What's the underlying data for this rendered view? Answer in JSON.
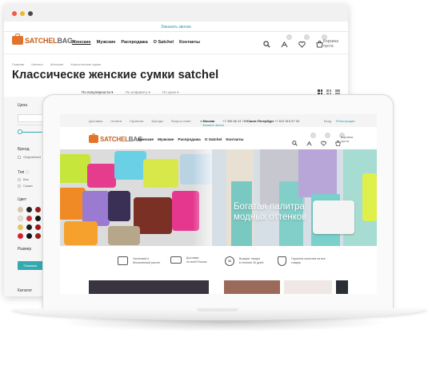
{
  "back_window": {
    "call_link": "Заказать звонок",
    "logo": {
      "part1": "SATCHEL",
      "part2": "BAG"
    },
    "nav": [
      "Женские",
      "Мужские",
      "Распродажа",
      "О Satchel",
      "Контакты"
    ],
    "icons": [
      {
        "name": "search-icon",
        "badge": ""
      },
      {
        "name": "compare-icon",
        "badge": "0"
      },
      {
        "name": "heart-icon",
        "badge": "0"
      },
      {
        "name": "cart-icon",
        "badge": "0"
      }
    ],
    "cart_text": [
      "Корзина",
      "пуста"
    ],
    "breadcrumbs": [
      "Главная",
      "Каталог",
      "Женские",
      "Классические сумки"
    ],
    "page_title": "Классическе женские сумки satchel",
    "sort": [
      "По популярности ▾",
      "По алфавиту ▾",
      "По цене ▾"
    ],
    "filters": {
      "price_label": "Цена",
      "brand_label": "Бренд",
      "brand_option": "Original/mini",
      "type_label": "Тип",
      "type_options": [
        "Все",
        "Сумки"
      ],
      "color_label": "Цвет",
      "size_label": "Размер",
      "show_button": "Показать",
      "catalog_label": "Каталог"
    },
    "swatch_colors": [
      "#d9c6a8",
      "#222222",
      "#9b1b1b",
      "#5b3a82",
      "#e9e3d5",
      "#c7383a",
      "#141414",
      "#6d2a7d",
      "#e8c25a",
      "#1d1d1d",
      "#a21515",
      "#8a1b8e",
      "#d8202b",
      "#151515",
      "#932222",
      ""
    ]
  },
  "screen": {
    "top_links": [
      "Доставка",
      "Оплата",
      "Гарантии",
      "Бренды",
      "Вопрос-ответ"
    ],
    "city1": "Москва",
    "phone1": "+7 495 66 24 789",
    "city2": "Санкт-Петербург",
    "phone2": "+7 812 515 67 34",
    "login": "Вход",
    "register": "Регистрация",
    "call_link": "Заказать звонок",
    "logo": {
      "part1": "SATCHEL",
      "part2": "BAG"
    },
    "nav": [
      "Женские",
      "Мужские",
      "Распродажа",
      "О Satchel",
      "Контакты"
    ],
    "cart_text": [
      "Корзина",
      "пуста"
    ],
    "hero_title_1": "Богатая палитра",
    "hero_title_2": "модных оттенков",
    "features": [
      {
        "icon": "wallet-icon",
        "line1": "Наличный и",
        "line2": "безналичный расчет"
      },
      {
        "icon": "truck-icon",
        "line1": "Доставка",
        "line2": "по всей России"
      },
      {
        "icon": "return-30-icon",
        "line1": "Возврат товара",
        "line2": "в течение 30 дней"
      },
      {
        "icon": "shield-star-icon",
        "line1": "Гарантия качества на все",
        "line2": "товары"
      }
    ]
  },
  "colors": {
    "accent": "#2d9aa4",
    "logo": "#e2732b"
  }
}
